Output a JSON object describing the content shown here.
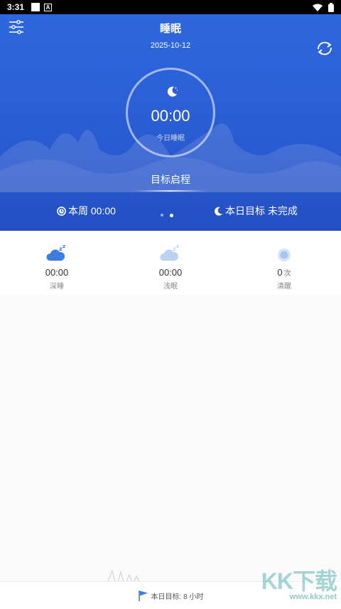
{
  "status_bar": {
    "time": "3:31",
    "icons": [
      "notification-icon",
      "app-a-icon",
      "wifi-icon",
      "battery-icon"
    ]
  },
  "header": {
    "title": "睡眠",
    "date": "2025-10-12",
    "ring": {
      "time": "00:00",
      "label": "今日睡眠"
    },
    "start_target": "目标启程",
    "week": "本周 00:00",
    "goal": "本日目标 未完成",
    "page_dots": 2,
    "active_dot": 2
  },
  "stats": [
    {
      "icon": "deep-sleep-cloud-icon",
      "value": "00:00",
      "unit": "",
      "label": "深睡"
    },
    {
      "icon": "light-sleep-cloud-icon",
      "value": "00:00",
      "unit": "",
      "label": "浅眠"
    },
    {
      "icon": "awake-eye-icon",
      "value": "0",
      "unit": "次",
      "label": "清醒"
    }
  ],
  "footer": {
    "target": "本日目标: 8 小时"
  },
  "watermark": {
    "big": "KK下载",
    "small": "www.kkx.net"
  },
  "colors": {
    "header_blue": "#2b5fd6",
    "icon_blue": "#3d7de0"
  }
}
